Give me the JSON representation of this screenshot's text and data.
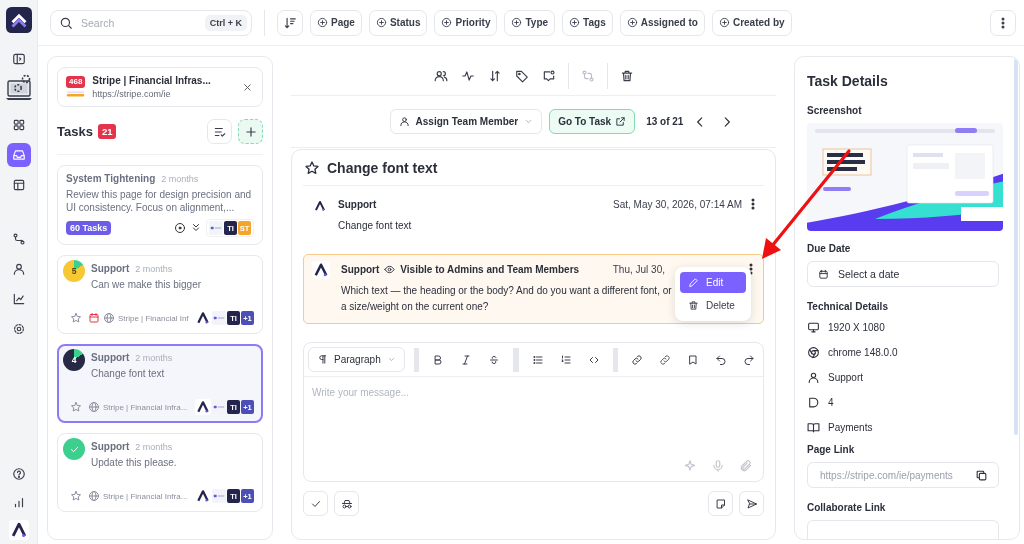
{
  "rail": {
    "nav": [
      {
        "selected": false
      },
      {
        "selected": true
      },
      {
        "selected": false
      },
      {
        "selected": false
      },
      {
        "selected": false
      },
      {
        "selected": false
      },
      {
        "selected": false
      }
    ]
  },
  "topbar": {
    "search": {
      "placeholder": "Search",
      "shortcut": "Ctrl + K"
    },
    "filters": [
      "Page",
      "Status",
      "Priority",
      "Type",
      "Tags",
      "Assigned to",
      "Created by"
    ]
  },
  "site": {
    "badge": "468",
    "title": "Stripe | Financial Infras...",
    "url": "https://stripe.com/ie"
  },
  "tasks": {
    "title": "Tasks",
    "count": "21",
    "items": [
      {
        "kind": "group",
        "selected": false,
        "title": "System Tightening",
        "time": "2 months",
        "text": "Review this page for design precision and UI consistency. Focus on alignment,...",
        "badge": "60 Tasks",
        "avatars": [
          {
            "label": "TI",
            "color": "#23254d"
          },
          {
            "label": "ST",
            "color": "#f5a52a"
          }
        ]
      },
      {
        "kind": "task",
        "selected": false,
        "done": false,
        "count": "5",
        "color": "#f6c833",
        "title": "Support",
        "time": "2 months",
        "text": "Can we make this bigger",
        "due": true,
        "site": "Stripe | Financial Inf",
        "avatars": [
          {
            "label": "TI",
            "color": "#23254d"
          },
          {
            "label": "+1",
            "color": "#4c4fb5"
          }
        ]
      },
      {
        "kind": "task",
        "selected": true,
        "done": false,
        "count": "4",
        "color": "#272a44",
        "title": "Support",
        "time": "2 months",
        "text": "Change font text",
        "due": false,
        "site": "Stripe | Financial Infra...",
        "avatars": [
          {
            "label": "TI",
            "color": "#23254d"
          },
          {
            "label": "+1",
            "color": "#4c4fb5"
          }
        ]
      },
      {
        "kind": "task",
        "selected": false,
        "done": true,
        "color": "#3ccf8e",
        "title": "Support",
        "time": "2 months",
        "text": "Update this please.",
        "due": false,
        "site": "Stripe | Financial Infra...",
        "avatars": [
          {
            "label": "TI",
            "color": "#23254d"
          },
          {
            "label": "+1",
            "color": "#4c4fb5"
          }
        ]
      }
    ]
  },
  "toolbar": [
    {
      "disabled": false
    },
    {
      "disabled": false
    },
    {
      "disabled": false
    },
    {
      "disabled": false
    },
    {
      "disabled": false
    },
    {
      "disabled": true
    },
    {
      "disabled": false
    }
  ],
  "navigation": {
    "assign": "Assign Team Member",
    "goto": "Go To Task",
    "position": "13 of 21"
  },
  "task": {
    "title": "Change font text",
    "starred": false,
    "comments": [
      {
        "kind": "public",
        "author": "Support",
        "date": "Sat, May 30, 2026, 07:14 AM",
        "text": "Change font text"
      },
      {
        "kind": "internal",
        "author": "Support",
        "visibility": "Visible to Admins and Team Members",
        "date": "Thu, Jul 30,",
        "text": "Which text — the heading or the body? And do you want a different font, or a size/weight on the current one?",
        "menu": [
          {
            "label": "Edit",
            "selected": true
          },
          {
            "label": "Delete",
            "selected": false
          }
        ]
      }
    ]
  },
  "editor": {
    "block": "Paragraph",
    "placeholder": "Write your message..."
  },
  "details": {
    "title": "Task Details",
    "screenshot_label": "Screenshot",
    "due_label": "Due Date",
    "due_placeholder": "Select a date",
    "tech_label": "Technical Details",
    "tech": [
      "1920 X 1080",
      "chrome 148.0.0",
      "Support",
      "4",
      "Payments"
    ],
    "page_link_label": "Page Link",
    "page_link": "https://stripe.com/ie/payments",
    "collab_label": "Collaborate Link"
  }
}
